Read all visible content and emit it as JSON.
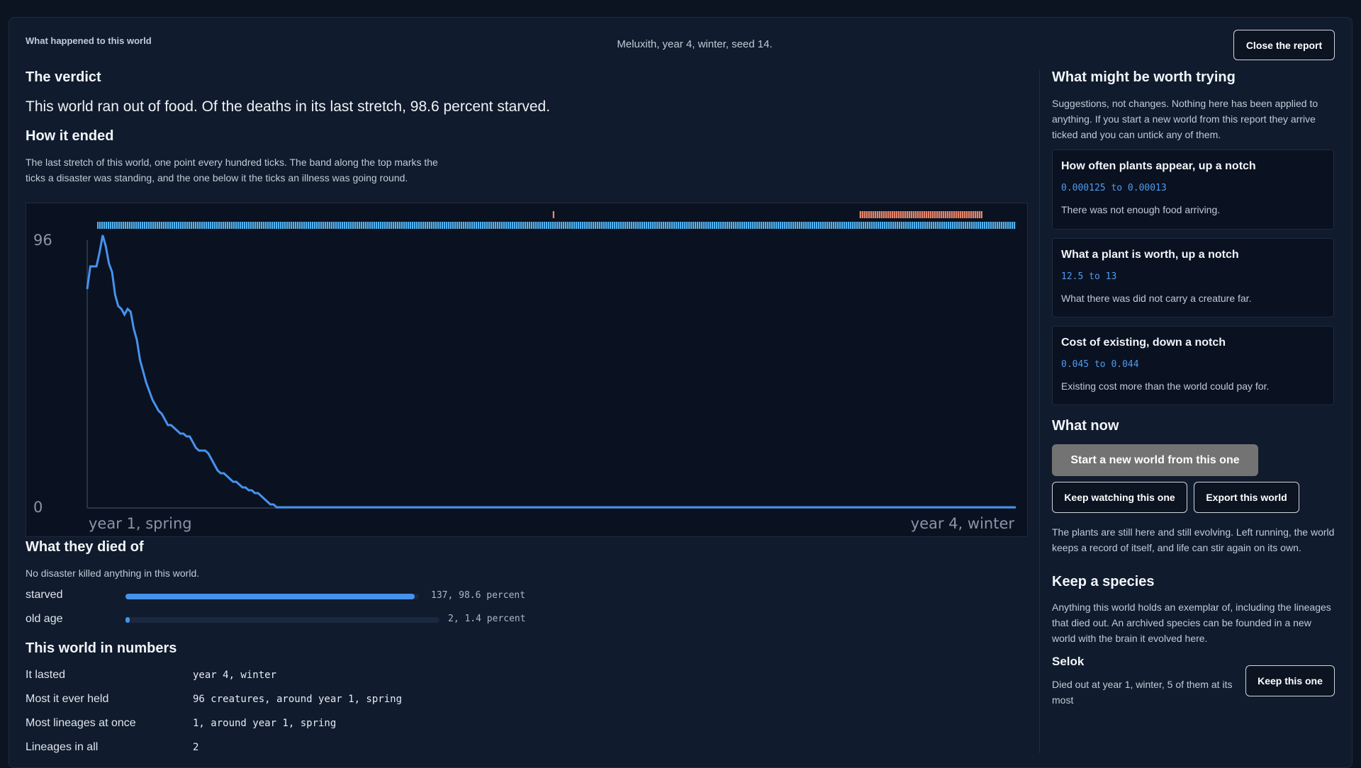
{
  "header": {
    "title": "What happened to this world",
    "meta": "Meluxith, year 4, winter, seed 14.",
    "close_label": "Close the report"
  },
  "verdict": {
    "heading": "The verdict",
    "text": "This world ran out of food. Of the deaths in its last stretch, 98.6 percent starved."
  },
  "ending": {
    "heading": "How it ended",
    "description": "The last stretch of this world, one point every hundred ticks. The band along the top marks the ticks a disaster was standing, and the one below it the ticks an illness was going round."
  },
  "chart_data": {
    "type": "line",
    "y_ticks": [
      "96",
      "0"
    ],
    "x_labels": [
      "year 1, spring",
      "year 4, winter"
    ],
    "ylim": [
      0,
      96
    ],
    "points": 300,
    "series": [
      {
        "values": [
          77,
          85,
          85,
          85,
          90,
          96,
          92,
          86,
          83,
          75,
          71,
          70,
          68,
          70,
          69,
          63,
          59,
          52,
          48,
          44,
          41,
          38,
          36,
          34,
          33,
          31,
          29,
          29,
          28,
          27,
          26,
          26,
          25,
          25,
          23,
          21,
          20,
          20,
          20,
          19,
          17,
          15,
          13,
          12,
          12,
          11,
          10,
          9,
          9,
          8,
          7,
          7,
          6,
          6,
          5,
          5,
          4,
          3,
          2,
          1,
          1,
          0
        ]
      }
    ],
    "disaster_band": [
      {
        "from": 0.496,
        "to": 0.498
      },
      {
        "from": 0.83,
        "to": 0.964
      }
    ],
    "illness_band": [
      {
        "from": 0.0,
        "to": 1.0
      }
    ],
    "colors": {
      "line": "#4593ee",
      "disaster": "#f08a6e",
      "illness": "#53b3f0",
      "axis": "#2a3446",
      "tick_text": "#8a95a6"
    }
  },
  "deaths": {
    "heading": "What they died of",
    "note": "No disaster killed anything in this world.",
    "causes": [
      {
        "label": "starved",
        "value": "137, 98.6 percent",
        "fraction": 0.986
      },
      {
        "label": "old age",
        "value": "2, 1.4 percent",
        "fraction": 0.014
      }
    ]
  },
  "numbers": {
    "heading": "This world in numbers",
    "rows": [
      {
        "label": "It lasted",
        "value": "year 4, winter"
      },
      {
        "label": "Most it ever held",
        "value": "96 creatures, around year 1, spring"
      },
      {
        "label": "Most lineages at once",
        "value": "1, around year 1, spring"
      },
      {
        "label": "Lineages in all",
        "value": "2"
      }
    ]
  },
  "suggestions": {
    "heading": "What might be worth trying",
    "intro": "Suggestions, not changes. Nothing here has been applied to anything. If you start a new world from this report they arrive ticked and you can untick any of them.",
    "items": [
      {
        "title": "How often plants appear, up a notch",
        "change": "0.000125 to 0.00013",
        "note": "There was not enough food arriving."
      },
      {
        "title": "What a plant is worth, up a notch",
        "change": "12.5 to 13",
        "note": "What there was did not carry a creature far."
      },
      {
        "title": "Cost of existing, down a notch",
        "change": "0.045 to 0.044",
        "note": "Existing cost more than the world could pay for."
      }
    ]
  },
  "what_now": {
    "heading": "What now",
    "primary": "Start a new world from this one",
    "keep_watching": "Keep watching this one",
    "export": "Export this world",
    "note": "The plants are still here and still evolving. Left running, the world keeps a record of itself, and life can stir again on its own."
  },
  "species": {
    "heading": "Keep a species",
    "intro": "Anything this world holds an exemplar of, including the lineages that died out. An archived species can be founded in a new world with the brain it evolved here.",
    "name": "Selok",
    "detail": "Died out at year 1, winter, 5 of them at its most",
    "keep_label": "Keep this one"
  }
}
